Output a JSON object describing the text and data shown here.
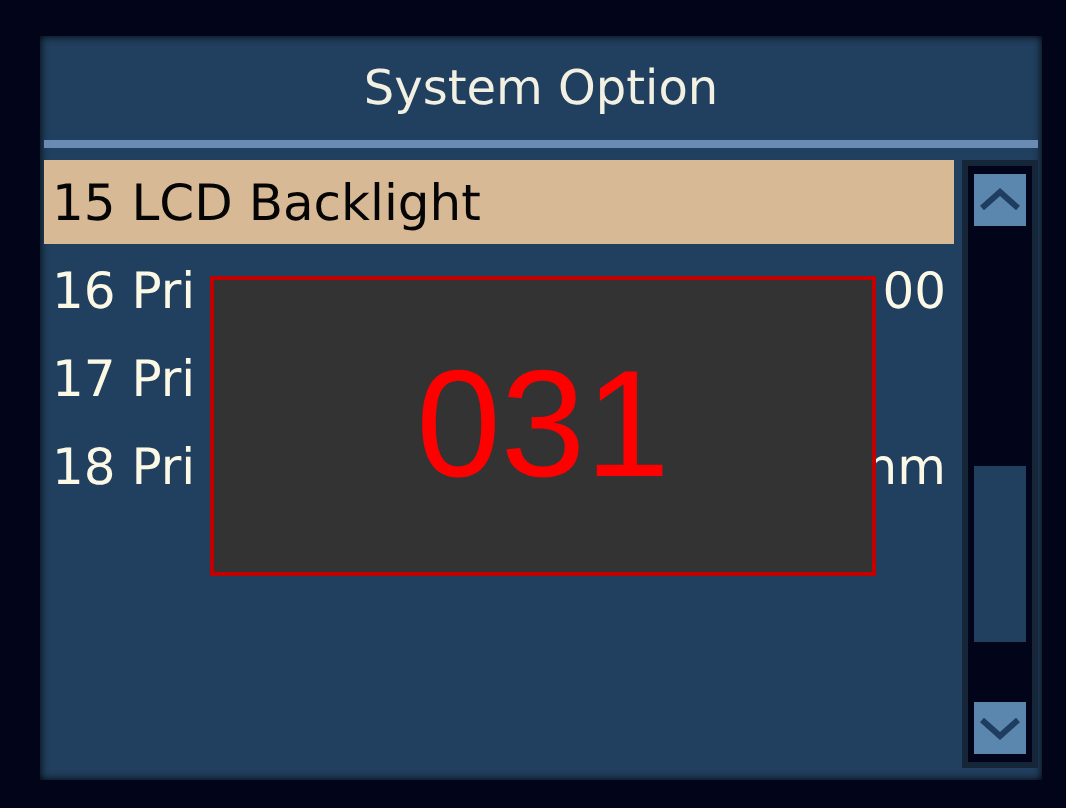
{
  "title": "System Option",
  "items": [
    {
      "label": "15 LCD Backlight",
      "selected": true
    },
    {
      "label": "16 Pri",
      "value": "00",
      "selected": false
    },
    {
      "label": "17 Pri",
      "selected": false
    },
    {
      "label": "18 Pri",
      "value": "nm",
      "selected": false
    }
  ],
  "popup": {
    "value": "031"
  }
}
